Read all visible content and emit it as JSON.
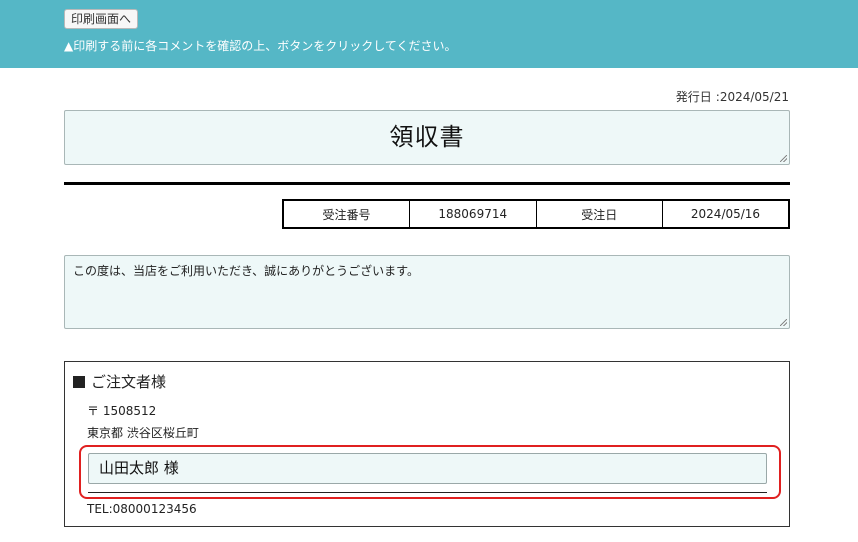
{
  "header": {
    "print_button_label": "印刷画面へ",
    "notice": "▲印刷する前に各コメントを確認の上、ボタンをクリックしてください。"
  },
  "issue": {
    "label": "発行日",
    "date": ":2024/05/21"
  },
  "document": {
    "title": "領収書"
  },
  "order": {
    "number_label": "受注番号",
    "number": "188069714",
    "date_label": "受注日",
    "date": "2024/05/16"
  },
  "message": "この度は、当店をご利用いただき、誠にありがとうございます。",
  "customer": {
    "heading": "ご注文者様",
    "postal": "〒 1508512",
    "address": "東京都 渋谷区桜丘町",
    "name": "山田太郎 様",
    "tel": "TEL:08000123456"
  },
  "colors": {
    "header_bg": "#55b7c6",
    "field_bg": "#eef8f8",
    "highlight": "#e02020"
  }
}
